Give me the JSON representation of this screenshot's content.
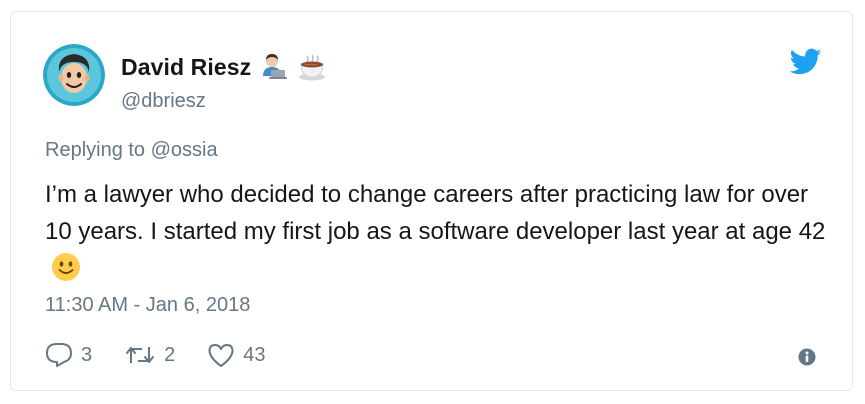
{
  "author": {
    "display_name": "David Riesz",
    "handle": "@dbriesz",
    "name_emojis": [
      "technologist-icon",
      "hot-beverage-icon"
    ]
  },
  "reply": {
    "prefix": "Replying to ",
    "mention": "@ossia"
  },
  "tweet": {
    "text": "I’m a lawyer who decided to change careers after practicing law for over 10 years. I started my first job as a software developer last year at age 42",
    "trailing_emoji": "slightly-smiling-face-icon",
    "timestamp": "11:30 AM - Jan 6, 2018"
  },
  "actions": {
    "replies": "3",
    "retweets": "2",
    "likes": "43"
  },
  "colors": {
    "twitter_blue": "#1da1f2",
    "muted_text": "#657786",
    "primary_text": "#14171a",
    "border": "#e1e8ed"
  }
}
